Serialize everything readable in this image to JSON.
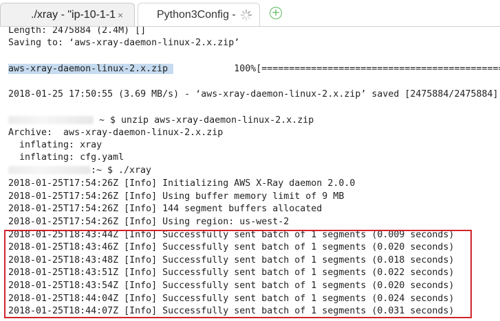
{
  "tabs": [
    {
      "label": "./xray - \"ip-10-1-1",
      "close": "×"
    },
    {
      "label": "Python3Config - "
    }
  ],
  "new_tab_symbol": "+",
  "terminal": {
    "lines": [
      "Length: 2475884 (2.4M) []",
      "Saving to: ‘aws-xray-daemon-linux-2.x.zip’",
      "",
      "",
      "",
      "2018-01-25 17:50:55 (3.69 MB/s) - ‘aws-xray-daemon-linux-2.x.zip’ saved [2475884/2475884]",
      "",
      "~ $ unzip aws-xray-daemon-linux-2.x.zip",
      "Archive:  aws-xray-daemon-linux-2.x.zip",
      "  inflating: xray",
      "  inflating: cfg.yaml",
      ":~ $ ./xray",
      "2018-01-25T17:54:26Z [Info] Initializing AWS X-Ray daemon 2.0.0",
      "2018-01-25T17:54:26Z [Info] Using buffer memory limit of 9 MB",
      "2018-01-25T17:54:26Z [Info] 144 segment buffers allocated",
      "2018-01-25T17:54:26Z [Info] Using region: us-west-2",
      "2018-01-25T18:43:44Z [Info] Successfully sent batch of 1 segments (0.009 seconds)",
      "2018-01-25T18:43:46Z [Info] Successfully sent batch of 1 segments (0.020 seconds)",
      "2018-01-25T18:43:48Z [Info] Successfully sent batch of 1 segments (0.018 seconds)",
      "2018-01-25T18:43:51Z [Info] Successfully sent batch of 1 segments (0.022 seconds)",
      "2018-01-25T18:43:54Z [Info] Successfully sent batch of 1 segments (0.020 seconds)",
      "2018-01-25T18:44:04Z [Info] Successfully sent batch of 1 segments (0.024 seconds)",
      "2018-01-25T18:44:07Z [Info] Successfully sent batch of 1 segments (0.031 seconds)"
    ],
    "progress_file": "aws-xray-daemon-linux-2.x.zip",
    "progress_text": "100%[==================================================="
  },
  "colors": {
    "highlight_border": "#d0232a",
    "selection": "#c6dbef",
    "new_tab_green": "#5cb85c"
  }
}
